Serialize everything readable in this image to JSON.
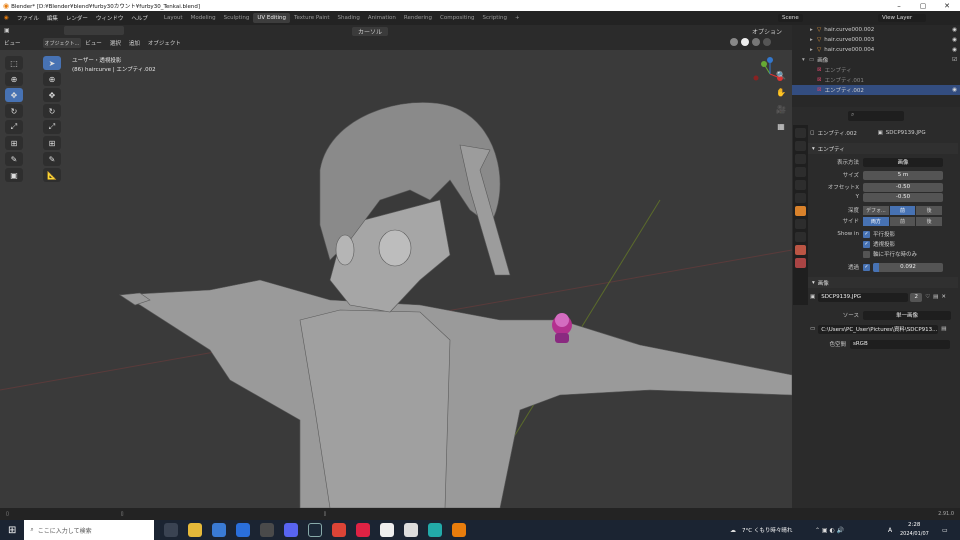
{
  "title": "Blender* [D:¥Blender¥blend¥furby30カウント¥furby30_Tenkai.blend]",
  "menus": [
    "ファイル",
    "編集",
    "レンダー",
    "ウィンドウ",
    "ヘルプ"
  ],
  "workspaces": [
    "Layout",
    "Modeling",
    "Sculpting",
    "UV Editing",
    "Texture Paint",
    "Shading",
    "Animation",
    "Rendering",
    "Compositing",
    "Scripting"
  ],
  "active_workspace": "UV Editing",
  "scene": "Scene",
  "view_layer": "View Layer",
  "options": "オプション",
  "viewport_header": {
    "items": [
      "ビュー",
      "オブジェクト...",
      "ビュー",
      "選択",
      "追加",
      "オブジェクト"
    ],
    "transform": "カーソル"
  },
  "viewport": {
    "view_name": "ユーザー・透視投影",
    "object_info": "(86) haircurve | エンプティ.002"
  },
  "outliner": {
    "rows": [
      {
        "label": "hair.curve000.002",
        "selected": false
      },
      {
        "label": "hair.curve000.003",
        "selected": false
      },
      {
        "label": "hair.curve000.004",
        "selected": false
      },
      {
        "label": "画像",
        "selected": false
      },
      {
        "label": "エンプティ",
        "selected": false
      },
      {
        "label": "エンプティ.001",
        "selected": false
      },
      {
        "label": "エンプティ.002",
        "selected": true
      }
    ]
  },
  "properties": {
    "object_name": "エンプティ.002",
    "data_name": "SDCP9139.JPG",
    "panel_empty": "エンプティ",
    "display_label": "表示方法",
    "display_value": "画像",
    "size_label": "サイズ",
    "size_value": "5 m",
    "offsetx_label": "オフセットX",
    "offsetx_value": "-0.50",
    "y_label": "Y",
    "y_value": "-0.50",
    "depth_label": "深度",
    "depth_options": [
      "デフォ...",
      "前",
      "後"
    ],
    "depth_active": 1,
    "side_label": "サイド",
    "side_options": [
      "両方",
      "前",
      "後"
    ],
    "side_active": 0,
    "showin_label": "Show in",
    "checks": [
      {
        "label": "平行投影",
        "on": true
      },
      {
        "label": "透視投影",
        "on": true
      },
      {
        "label": "軸に平行な時のみ",
        "on": false
      }
    ],
    "opacity_label": "透過",
    "opacity_value": "0.092",
    "panel_image": "画像",
    "image_name": "SDCP9139.JPG",
    "image_users": "2",
    "source_label": "ソース",
    "source_value": "単一画像",
    "filepath": "C:\\Users\\PC_User\\Pictures\\資料\\SDCP913...",
    "colorspace_label": "色空間",
    "colorspace_value": "sRGB"
  },
  "status": {
    "version": "2.91.0"
  },
  "taskbar": {
    "search_placeholder": "ここに入力して検索",
    "weather": "7°C くもり時々晴れ",
    "ime": "A",
    "time": "2:28",
    "date": "2024/01/07"
  }
}
